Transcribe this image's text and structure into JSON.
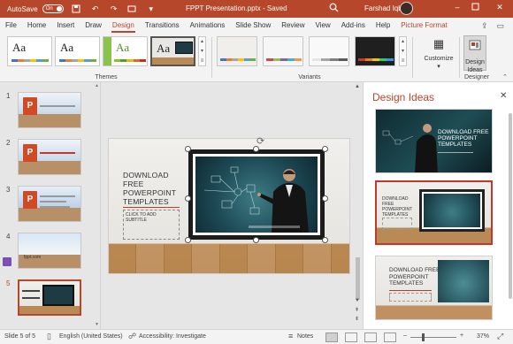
{
  "titlebar": {
    "autosave_label": "AutoSave",
    "autosave_state": "On",
    "document_title": "FPPT Presentation.pptx - Saved",
    "user_name": "Farshad Iqbal",
    "icons": [
      "save-icon",
      "undo-icon",
      "redo-icon",
      "present-icon",
      "customize-icon",
      "search-icon",
      "minimize-icon",
      "restore-icon",
      "close-icon"
    ]
  },
  "ribbon_tabs": [
    {
      "label": "File"
    },
    {
      "label": "Home"
    },
    {
      "label": "Insert"
    },
    {
      "label": "Draw"
    },
    {
      "label": "Design",
      "active": true
    },
    {
      "label": "Transitions"
    },
    {
      "label": "Animations"
    },
    {
      "label": "Slide Show"
    },
    {
      "label": "Review"
    },
    {
      "label": "View"
    },
    {
      "label": "Add-ins"
    },
    {
      "label": "Help"
    },
    {
      "label": "Picture Format",
      "contextual": true
    }
  ],
  "ribbon": {
    "themes_label": "Themes",
    "theme_thumbnail_text": "Aa",
    "variants_label": "Variants",
    "customize_label": "Customize",
    "designer_label": "Designer",
    "design_ideas_label_line1": "Design",
    "design_ideas_label_line2": "Ideas"
  },
  "slides": [
    {
      "number": "1"
    },
    {
      "number": "2"
    },
    {
      "number": "3"
    },
    {
      "number": "4",
      "caption": "fppt.com"
    },
    {
      "number": "5",
      "active": true
    }
  ],
  "current_slide": {
    "title_lines": [
      "DOWNLOAD",
      "FREE",
      "POWERPOINT",
      "TEMPLATES"
    ],
    "subtitle_placeholder": "CLICK TO ADD SUBTITLE"
  },
  "design_ideas": {
    "title": "Design Ideas",
    "idea1_title": "DOWNLOAD FREE POWERPOINT TEMPLATES",
    "idea2_title": "DOWNLOAD FREE POWERPOINT TEMPLATES",
    "idea3_title": "DOWNLOAD FREE POWERPOINT TEMPLATES"
  },
  "statusbar": {
    "slide_indicator": "Slide 5 of 5",
    "language": "English (United States)",
    "accessibility": "Accessibility: Investigate",
    "notes_label": "Notes",
    "zoom": "37%"
  },
  "colors": {
    "accent": "#b7472a",
    "selection": "#c0392b"
  }
}
